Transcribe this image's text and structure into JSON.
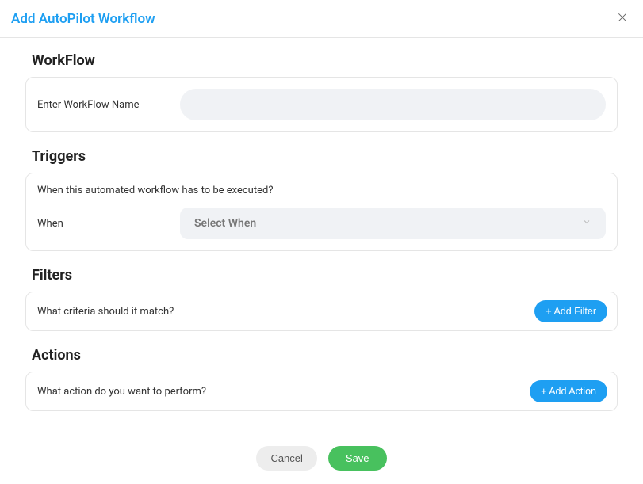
{
  "header": {
    "title": "Add AutoPilot Workflow"
  },
  "workflow": {
    "section_title": "WorkFlow",
    "name_label": "Enter WorkFlow Name",
    "name_value": ""
  },
  "triggers": {
    "section_title": "Triggers",
    "question": "When this automated workflow has to be executed?",
    "when_label": "When",
    "when_placeholder": "Select When"
  },
  "filters": {
    "section_title": "Filters",
    "question": "What criteria should it match?",
    "add_button": "+ Add Filter"
  },
  "actions": {
    "section_title": "Actions",
    "question": "What action do you want to perform?",
    "add_button": "+ Add Action"
  },
  "footer": {
    "cancel": "Cancel",
    "save": "Save"
  }
}
